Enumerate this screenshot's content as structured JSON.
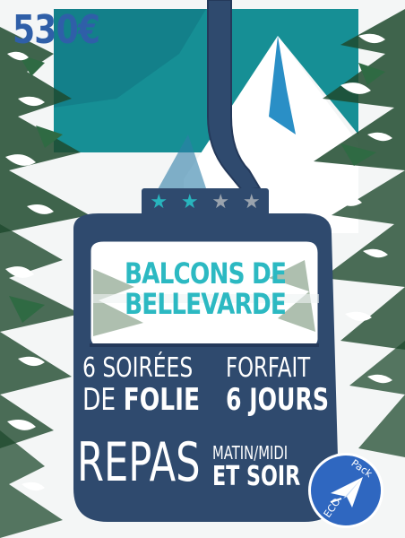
{
  "price": "530€",
  "rating": {
    "filled": 2,
    "total": 4
  },
  "title": {
    "line1": "BALCONS DE",
    "line2": "BELLEVARDE"
  },
  "soirees": {
    "line1": "6 SOIRÉES",
    "line2_prefix": "DE",
    "line2_emph": "FOLIE"
  },
  "forfait": {
    "line1": "FORFAIT",
    "line2": "6 JOURS"
  },
  "repas": {
    "main": "REPAS",
    "line1": "MATIN/MIDI",
    "line2": "ET SOIR"
  },
  "badge": {
    "top": "Pack",
    "bottom": "ECO",
    "icon": "paper-plane-icon"
  },
  "colors": {
    "teal": "#2cb9c2",
    "navy": "#2f4a6e",
    "price": "#2f5fa8",
    "badge": "#2f67c0",
    "tree": "#1f4a2e"
  }
}
